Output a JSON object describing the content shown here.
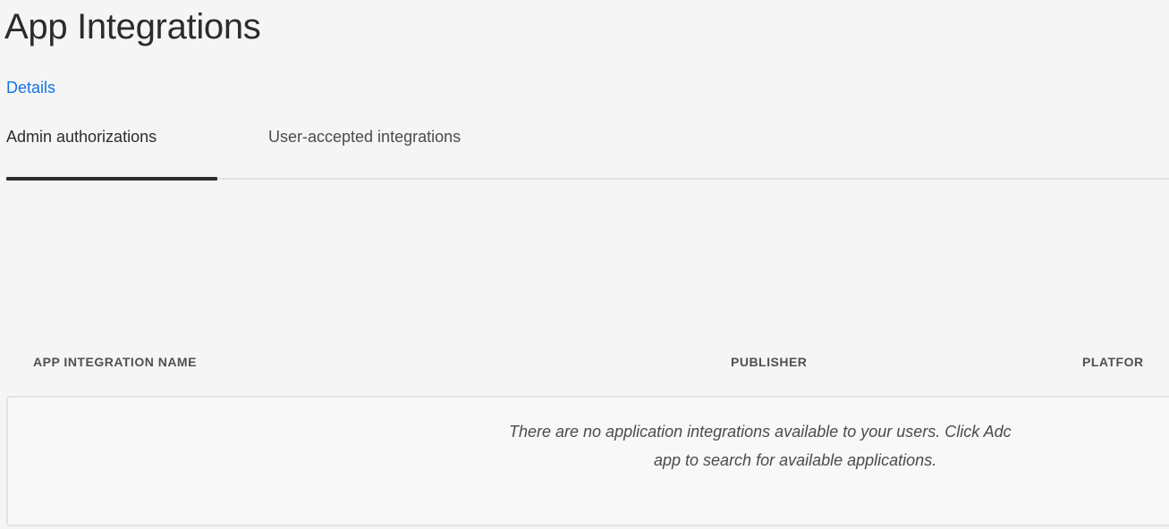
{
  "header": {
    "title": "App Integrations",
    "details_link": "Details"
  },
  "tabs": [
    {
      "label": "Admin authorizations",
      "selected": true
    },
    {
      "label": "User-accepted integrations",
      "selected": false
    }
  ],
  "table": {
    "columns": [
      "APP INTEGRATION NAME",
      "PUBLISHER",
      "PLATFOR"
    ],
    "empty_message": {
      "line1": "There are no application integrations available to your users. Click Adc",
      "line2": "app to search for available applications."
    }
  },
  "colors": {
    "link": "#1473e6",
    "text": "#2c2c2c",
    "background": "#f5f5f5"
  }
}
